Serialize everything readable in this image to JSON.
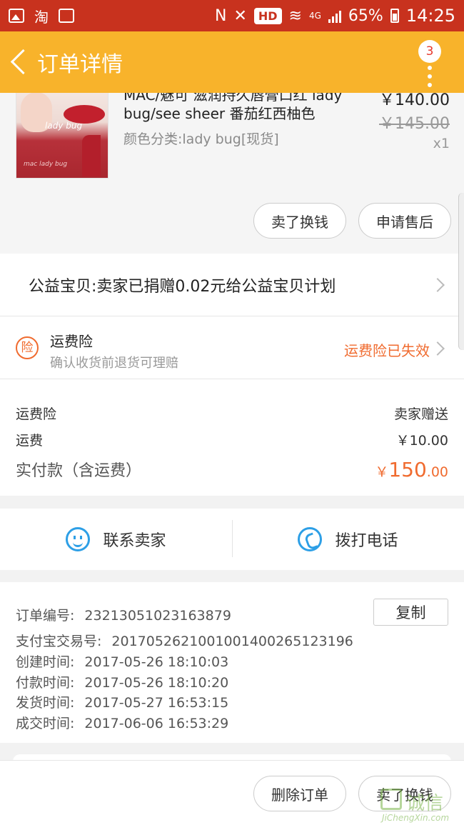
{
  "status_bar": {
    "carrier_icons": [
      "image-icon",
      "taobao-icon",
      "clipboard-icon"
    ],
    "taobao_glyph": "淘",
    "nfc": "N",
    "hd": "HD",
    "network": "4G",
    "battery": "65%",
    "time": "14:25"
  },
  "header": {
    "title": "订单详情",
    "badge_count": "3"
  },
  "product": {
    "title": "MAC/魅可 滋润持久唇膏口红 lady bug/see sheer 番茄红西柚色",
    "spec": "颜色分类:lady bug[现货]",
    "price": "￥140.00",
    "original_price": "￥145.00",
    "quantity": "x1",
    "image_label": "lady bug",
    "image_brand": "mac lady bug",
    "sell_button": "卖了换钱",
    "aftersale_button": "申请售后"
  },
  "charity": {
    "text": "公益宝贝:卖家已捐赠0.02元给公益宝贝计划"
  },
  "insurance": {
    "icon_text": "险",
    "title": "运费险",
    "subtitle": "确认收货前退货可理赔",
    "status": "运费险已失效"
  },
  "fees": {
    "insurance_label": "运费险",
    "insurance_value": "卖家赠送",
    "shipping_label": "运费",
    "shipping_value": "￥10.00",
    "total_label": "实付款（含运费）",
    "total_currency": "￥",
    "total_int": "150",
    "total_dec": ".00"
  },
  "contact": {
    "seller": "联系卖家",
    "phone": "拨打电话"
  },
  "order_info": {
    "order_no_label": "订单编号:",
    "order_no": "23213051023163879",
    "copy_button": "复制",
    "alipay_label": "支付宝交易号:",
    "alipay_no": "2017052621001001400265123196",
    "created_label": "创建时间:",
    "created": "2017-05-26 18:10:03",
    "paid_label": "付款时间:",
    "paid": "2017-05-26 18:10:20",
    "shipped_label": "发货时间:",
    "shipped": "2017-05-27 16:53:15",
    "done_label": "成交时间:",
    "done": "2017-06-06 16:53:29"
  },
  "bottom": {
    "delete_button": "删除订单",
    "sell_button": "卖了换钱"
  },
  "watermark": {
    "text": "诚信",
    "sub": "JiChengXin.com"
  },
  "colors": {
    "status_bar": "#c8321e",
    "header": "#f8b32b",
    "accent_orange": "#f06b2f",
    "accent_blue": "#2d9fe6"
  }
}
